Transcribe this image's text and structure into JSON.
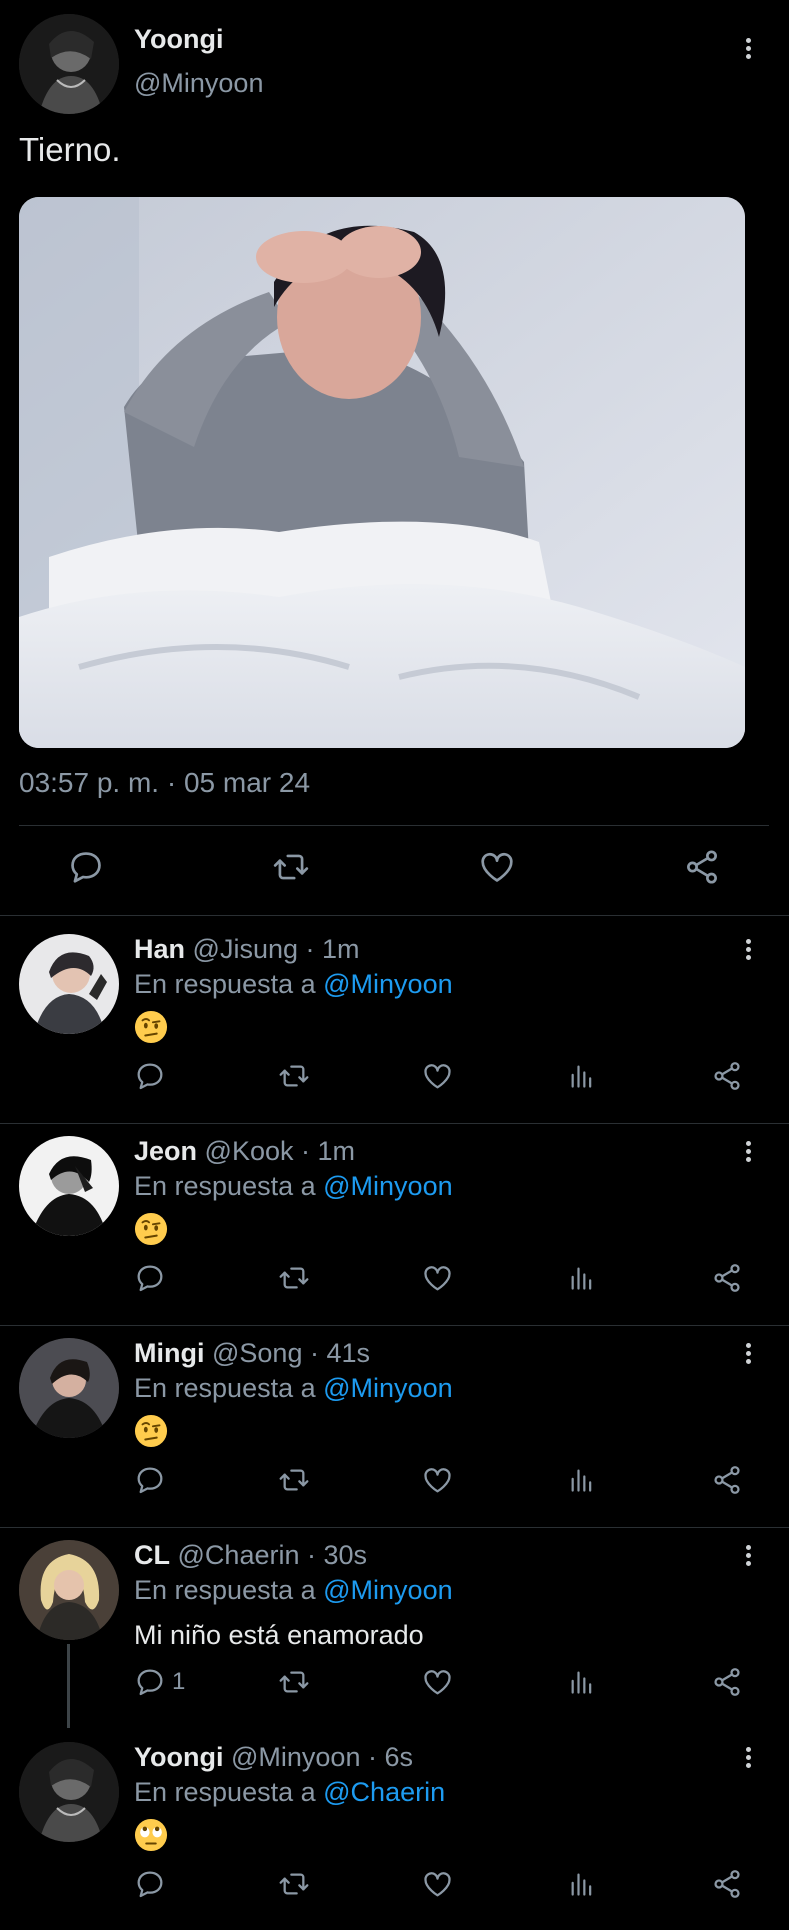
{
  "main_tweet": {
    "name": "Yoongi",
    "handle": "@Minyoon",
    "text": "Tierno.",
    "timestamp": "03:57 p. m. · 05 mar 24",
    "image_alt": "Person in grey shirt holding head in bed",
    "actions": [
      "reply-icon",
      "retweet-icon",
      "like-icon",
      "share-icon"
    ]
  },
  "replies": [
    {
      "name": "Han",
      "meta": "@Jisung · 1m",
      "reply_prefix": "En respuesta a",
      "reply_to": "@Minyoon",
      "body_emoji": "face-with-raised-eyebrow",
      "body_text": "",
      "reply_count": ""
    },
    {
      "name": "Jeon",
      "meta": "@Kook · 1m",
      "reply_prefix": "En respuesta a",
      "reply_to": "@Minyoon",
      "body_emoji": "face-with-raised-eyebrow",
      "body_text": "",
      "reply_count": ""
    },
    {
      "name": "Mingi",
      "meta": "@Song · 41s",
      "reply_prefix": "En respuesta a",
      "reply_to": "@Minyoon",
      "body_emoji": "face-with-raised-eyebrow",
      "body_text": "",
      "reply_count": ""
    },
    {
      "name": "CL",
      "meta": "@Chaerin · 30s",
      "reply_prefix": "En respuesta a",
      "reply_to": "@Minyoon",
      "body_emoji": "",
      "body_text": "Mi niño está enamorado",
      "reply_count": "1"
    },
    {
      "name": "Yoongi",
      "meta": "@Minyoon · 6s",
      "reply_prefix": "En respuesta a",
      "reply_to": "@Chaerin",
      "body_emoji": "face-with-rolling-eyes",
      "body_text": "",
      "reply_count": ""
    }
  ],
  "colors": {
    "background": "#000000",
    "text": "#e7e9ea",
    "secondary": "#8b98a5",
    "mention": "#1d9bf0",
    "divider": "#2a2f33"
  }
}
